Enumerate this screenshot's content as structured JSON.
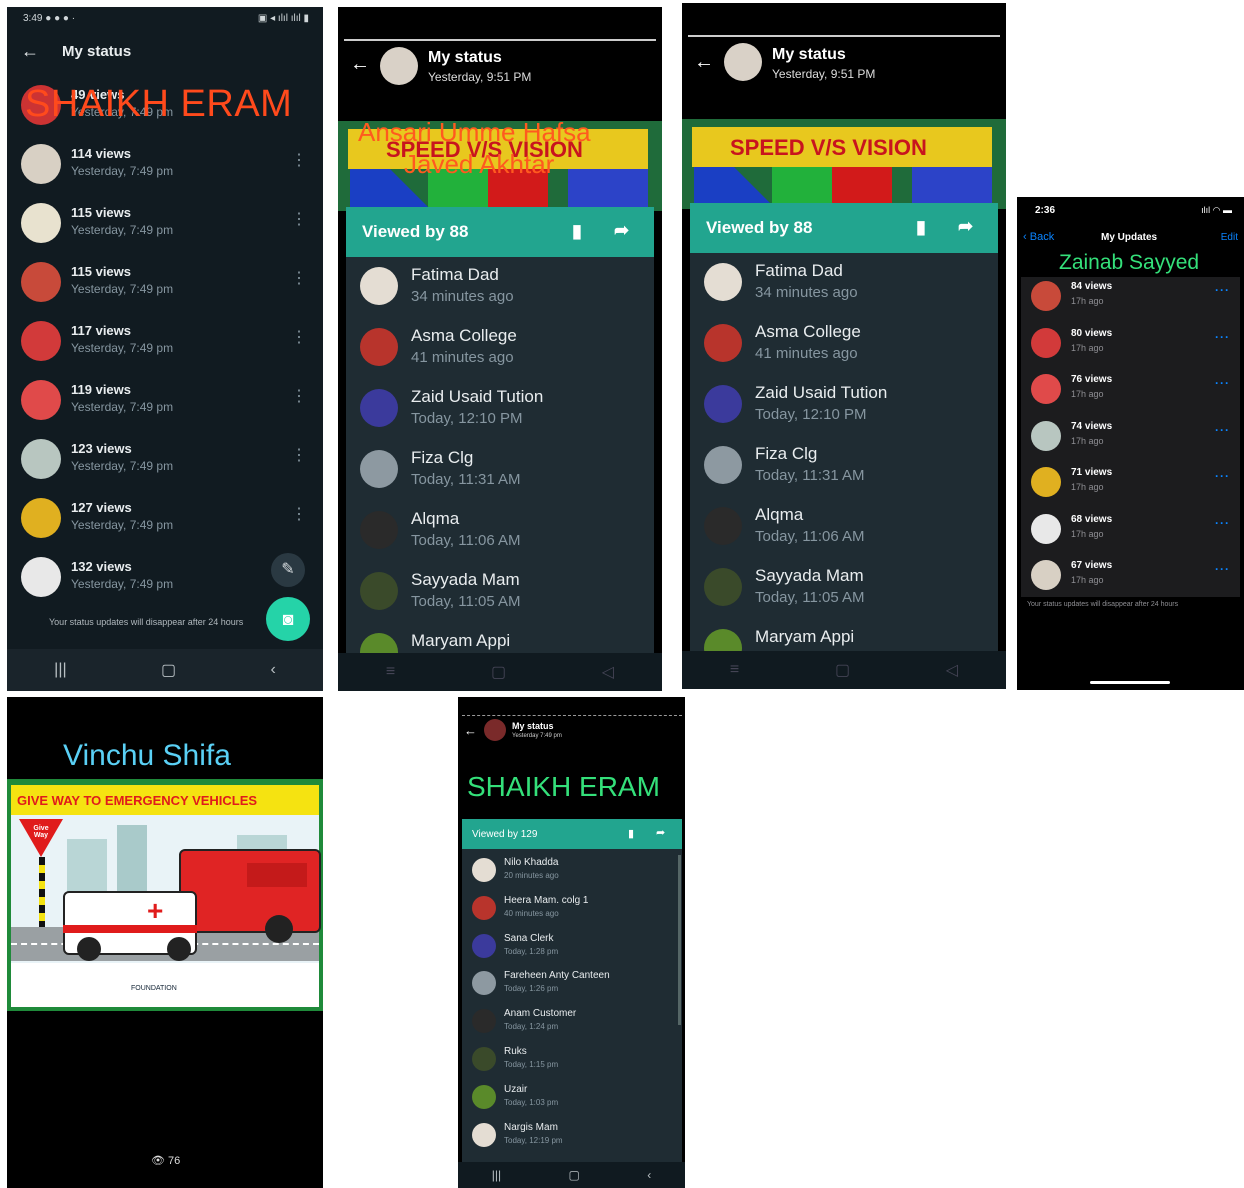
{
  "panel1": {
    "status_time": "3:49",
    "title": "My status",
    "overlay_label": "SHAIKH ERAM",
    "first_row": {
      "views": "49 views",
      "time": "Yesterday, 7:49 pm"
    },
    "rows": [
      {
        "views": "114 views",
        "time": "Yesterday, 7:49 pm"
      },
      {
        "views": "115 views",
        "time": "Yesterday, 7:49 pm"
      },
      {
        "views": "115 views",
        "time": "Yesterday, 7:49 pm"
      },
      {
        "views": "117 views",
        "time": "Yesterday, 7:49 pm"
      },
      {
        "views": "119 views",
        "time": "Yesterday, 7:49 pm"
      },
      {
        "views": "123 views",
        "time": "Yesterday, 7:49 pm"
      },
      {
        "views": "127 views",
        "time": "Yesterday, 7:49 pm"
      },
      {
        "views": "132 views",
        "time": "Yesterday, 7:49 pm"
      }
    ],
    "footer_note": "Your status updates will disappear after 24 hours"
  },
  "panel2": {
    "title": "My status",
    "subtitle": "Yesterday, 9:51 PM",
    "overlay_line1": "Ansari Umme Hafsa",
    "overlay_line2": "Javed Akhtar",
    "banner_text": "SPEED V/S VISION",
    "viewed_by": "Viewed by 88"
  },
  "panel3": {
    "title": "My status",
    "subtitle": "Yesterday, 9:51 PM",
    "banner_text": "SPEED V/S VISION",
    "viewed_by": "Viewed by 88"
  },
  "viewers": [
    {
      "name": "Fatima Dad",
      "time": "34 minutes ago"
    },
    {
      "name": "Asma College",
      "time": "41 minutes ago"
    },
    {
      "name": "Zaid Usaid Tution",
      "time": "Today, 12:10 PM"
    },
    {
      "name": "Fiza Clg",
      "time": "Today, 11:31 AM"
    },
    {
      "name": "Alqma",
      "time": "Today, 11:06 AM"
    },
    {
      "name": "Sayyada Mam",
      "time": "Today, 11:05 AM"
    },
    {
      "name": "Maryam Appi",
      "time": ""
    }
  ],
  "panel4": {
    "time": "2:36",
    "back": "Back",
    "title": "My Updates",
    "edit": "Edit",
    "overlay_label": "Zainab Sayyed",
    "rows": [
      {
        "views": "84 views",
        "time": "17h ago"
      },
      {
        "views": "80 views",
        "time": "17h ago"
      },
      {
        "views": "76 views",
        "time": "17h ago"
      },
      {
        "views": "74 views",
        "time": "17h ago"
      },
      {
        "views": "71 views",
        "time": "17h ago"
      },
      {
        "views": "68 views",
        "time": "17h ago"
      },
      {
        "views": "67 views",
        "time": "17h ago"
      }
    ],
    "footer_note": "Your status updates will disappear after 24 hours"
  },
  "panel5": {
    "overlay_label": "Vinchu Shifa",
    "poster_title": "GIVE WAY TO EMERGENCY VEHICLES",
    "sign_text": "Give Way",
    "foundation": "FOUNDATION",
    "view_count": "76"
  },
  "panel6": {
    "title": "My status",
    "subtitle": "Yesterday 7:49 pm",
    "overlay_label": "SHAIKH ERAM",
    "viewed_by": "Viewed by 129",
    "viewers": [
      {
        "name": "Nilo Khadda",
        "time": "20 minutes ago"
      },
      {
        "name": "Heera Mam. colg 1",
        "time": "40 minutes ago"
      },
      {
        "name": "Sana Clerk",
        "time": "Today, 1:28 pm"
      },
      {
        "name": "Fareheen Anty Canteen",
        "time": "Today, 1:26 pm"
      },
      {
        "name": "Anam Customer",
        "time": "Today, 1:24 pm"
      },
      {
        "name": "Ruks",
        "time": "Today, 1:15 pm"
      },
      {
        "name": "Uzair",
        "time": "Today, 1:03 pm"
      },
      {
        "name": "Nargis Mam",
        "time": "Today, 12:19 pm"
      }
    ]
  }
}
